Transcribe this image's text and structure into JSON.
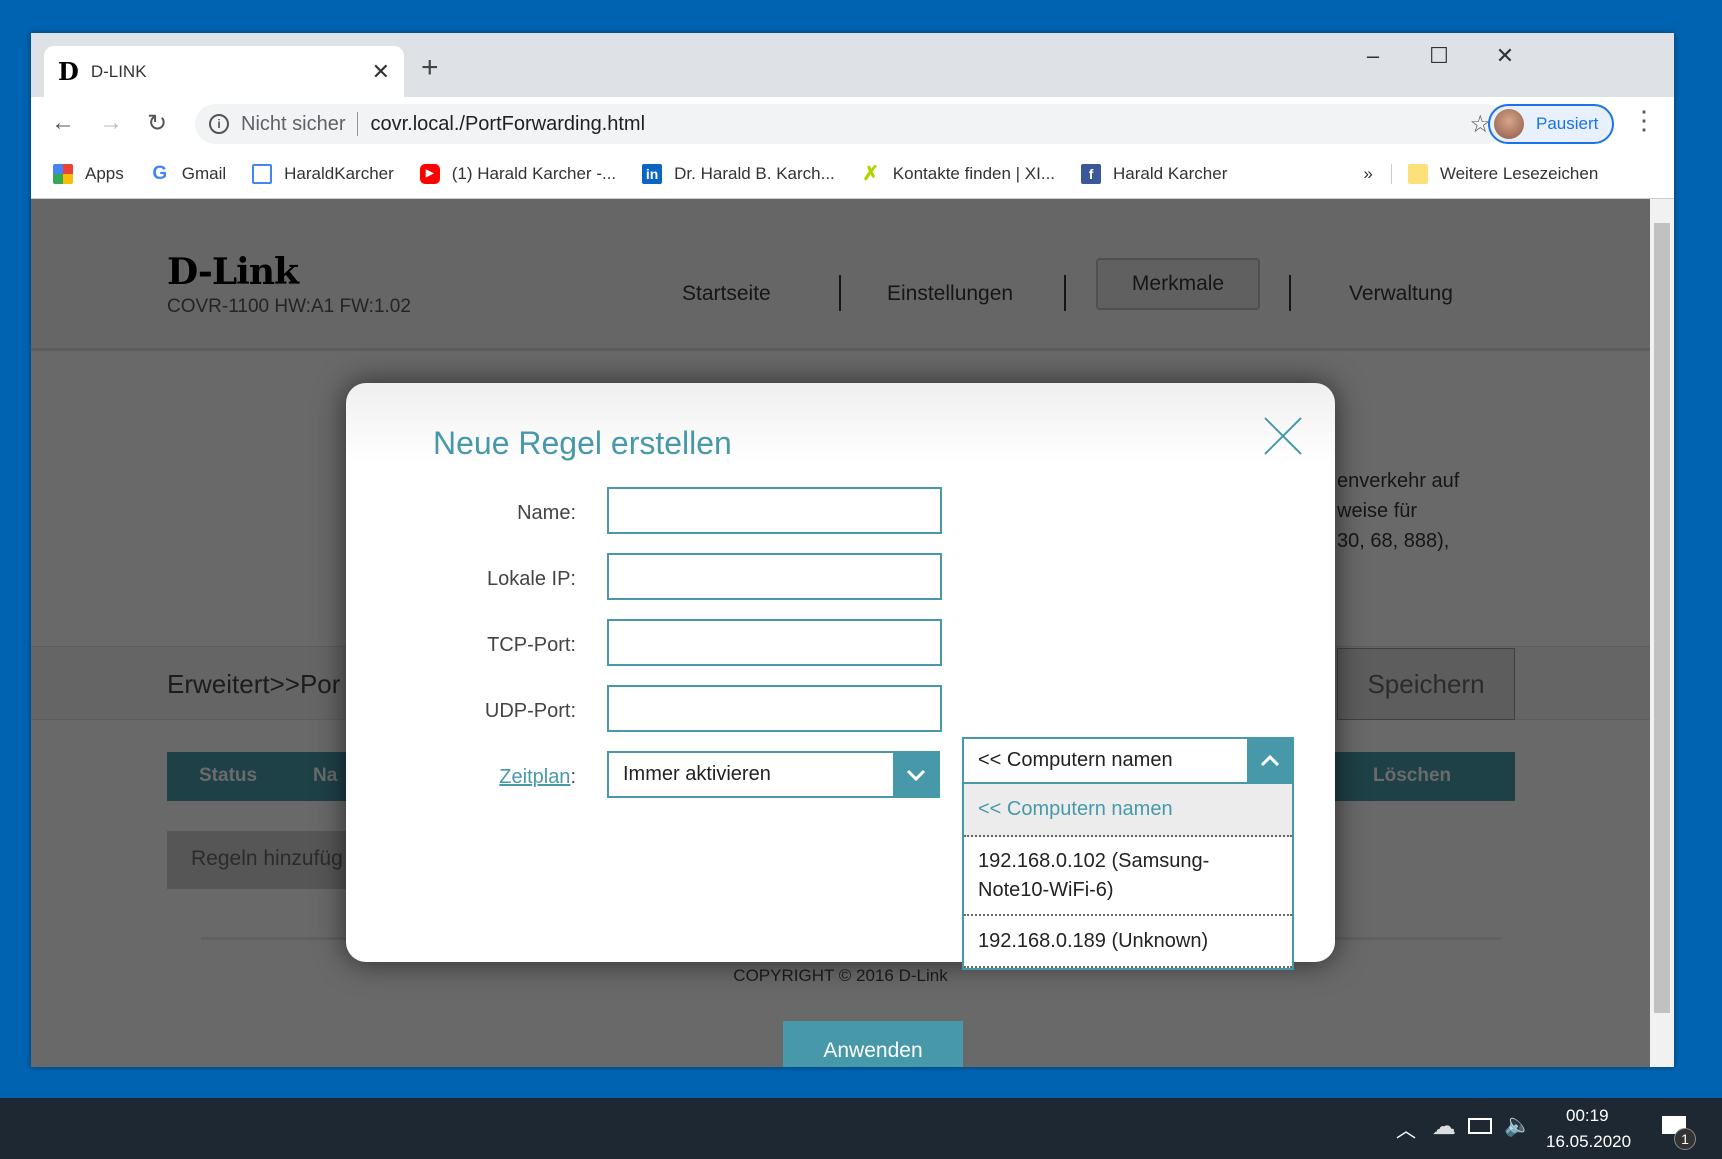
{
  "browser": {
    "tab_title": "D-LINK",
    "favicon_letter": "D",
    "new_tab": "+",
    "window_controls": {
      "minimize": "–",
      "maximize": "☐",
      "close": "✕"
    },
    "security_label": "Nicht sicher",
    "url": "covr.local./PortForwarding.html",
    "profile_label": "Pausiert",
    "bookmarks": [
      "Apps",
      "Gmail",
      "HaraldKarcher",
      "(1) Harald Karcher -...",
      "Dr. Harald B. Karch...",
      "Kontakte finden | XI...",
      "Harald Karcher"
    ],
    "bookmarks_overflow": "»",
    "other_bookmarks": "Weitere Lesezeichen"
  },
  "page": {
    "logo": "D-Link",
    "model": "COVR-1100 HW:A1 FW:1.02",
    "nav": [
      "Startseite",
      "Einstellungen",
      "Merkmale",
      "Verwaltung"
    ],
    "description_lines": [
      "enverkehr auf",
      "weise für",
      "30, 68, 888),"
    ],
    "breadcrumb": "Erweitert>>Por",
    "save": "Speichern",
    "table_headers": {
      "status": "Status",
      "name": "Na",
      "delete": "Löschen"
    },
    "add_rules": "Regeln hinzufüg",
    "copyright": "COPYRIGHT © 2016 D-Link"
  },
  "modal": {
    "title": "Neue Regel erstellen",
    "labels": {
      "name": "Name:",
      "local_ip": "Lokale IP:",
      "tcp": "TCP-Port:",
      "udp": "UDP-Port:",
      "schedule": "Zeitplan",
      ":": ":"
    },
    "values": {
      "name": "",
      "local_ip": "",
      "tcp": "",
      "udp": ""
    },
    "schedule_value": "Immer aktivieren",
    "computer_select": "<< Computern namen",
    "computer_options": [
      "<< Computern namen",
      "192.168.0.102 (Samsung-Note10-WiFi-6)",
      "192.168.0.189 (Unknown)"
    ],
    "computer_option_lines": [
      [
        "<< Computern namen"
      ],
      [
        "192.168.0.102 (Samsung-",
        "Note10-WiFi-6)"
      ],
      [
        "192.168.0.189 (Unknown)"
      ]
    ],
    "apply": "Anwenden"
  },
  "taskbar": {
    "time": "00:19",
    "date": "16.05.2020",
    "notifications": "1"
  },
  "colors": {
    "accent": "#4799a9",
    "desktop": "#0063b1",
    "taskbar": "#1e2833"
  }
}
